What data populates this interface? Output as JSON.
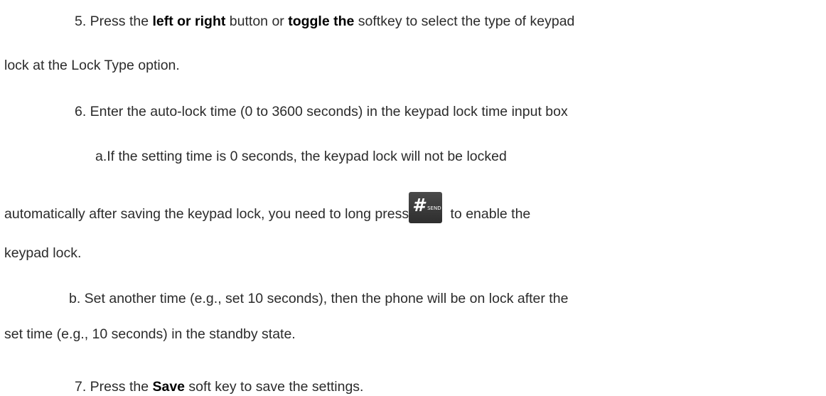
{
  "step5": {
    "prefix": "5. Press the ",
    "bold1": "left or right",
    "mid1": " button or ",
    "bold2": "toggle the",
    "suffix": " softkey to select the type of keypad",
    "continuation": "lock at the Lock Type option."
  },
  "step6": {
    "text": "6. Enter the auto-lock time (0 to 3600 seconds) in the keypad lock time input box",
    "a_line1": "a.If the setting time is 0 seconds, the keypad lock will not be locked",
    "a_line2_before": "automatically after saving the keypad lock, you need to long press",
    "a_line2_after": " to enable the",
    "a_line3": "keypad lock.",
    "b_line1": "b. Set another time (e.g., set 10 seconds), then the phone will be on lock after the",
    "b_line2": "set time (e.g., 10 seconds) in the standby state."
  },
  "key_icon": {
    "symbol": "#",
    "sublabel": "SEND",
    "icon": "hash-send-key-icon"
  },
  "step7": {
    "prefix": "7. Press the ",
    "bold": "Save",
    "suffix": " soft key to save the settings."
  }
}
